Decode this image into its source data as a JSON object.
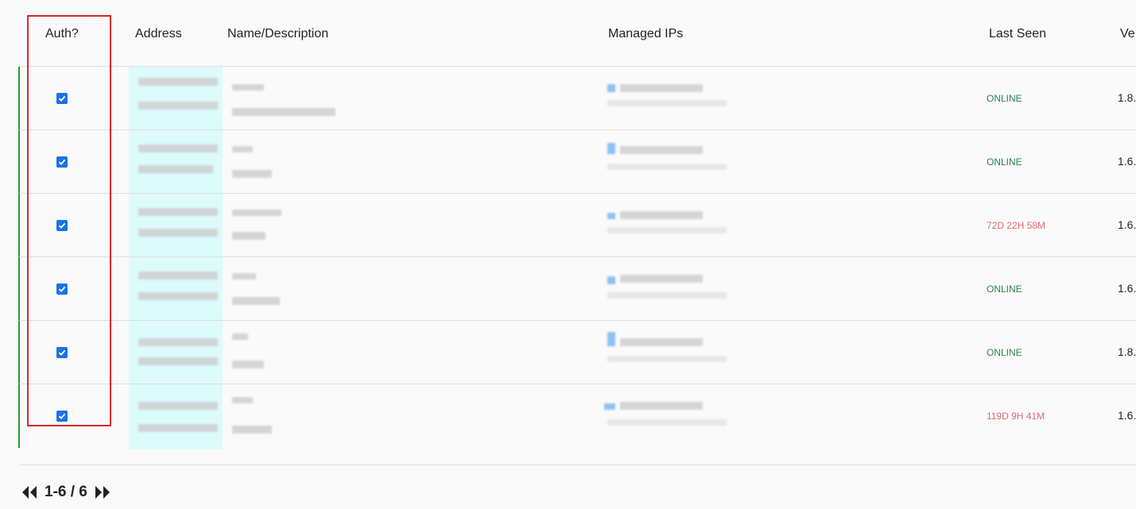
{
  "table": {
    "headers": {
      "auth": "Auth?",
      "address": "Address",
      "name": "Name/Description",
      "managed_ips": "Managed IPs",
      "last_seen": "Last Seen",
      "version": "Ve"
    },
    "rows": [
      {
        "authorized": true,
        "last_seen": "ONLINE",
        "status": "online",
        "version": "1.8."
      },
      {
        "authorized": true,
        "last_seen": "ONLINE",
        "status": "online",
        "version": "1.6."
      },
      {
        "authorized": true,
        "last_seen": "72D 22H 58M",
        "status": "offline",
        "version": "1.6."
      },
      {
        "authorized": true,
        "last_seen": "ONLINE",
        "status": "online",
        "version": "1.6."
      },
      {
        "authorized": true,
        "last_seen": "ONLINE",
        "status": "online",
        "version": "1.8."
      },
      {
        "authorized": true,
        "last_seen": "119D 9H 41M",
        "status": "offline",
        "version": "1.6."
      }
    ]
  },
  "pagination": {
    "range_label": "1-6 / 6",
    "prev_icon": "double-left-icon",
    "next_icon": "double-right-icon"
  },
  "colors": {
    "checkbox": "#1a73e8",
    "online": "#2e7d4f",
    "offline": "#e06b6b",
    "accent_bar": "#2a9a2a",
    "highlight": "#d42a2a"
  }
}
